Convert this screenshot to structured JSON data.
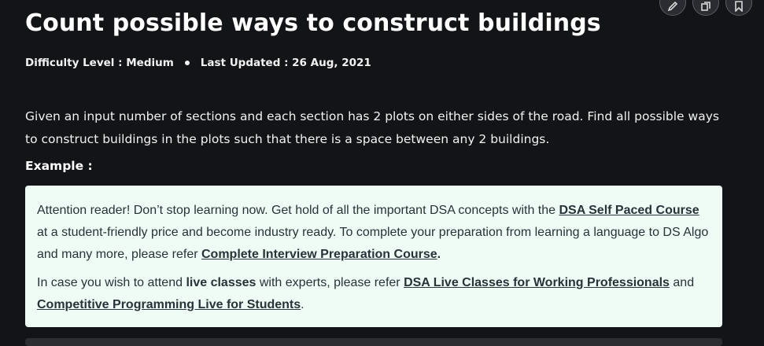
{
  "article": {
    "title": "Count possible ways to construct buildings",
    "difficulty": "Difficulty Level : Medium",
    "last_updated": "Last Updated : 26 Aug, 2021",
    "description": "Given an input number of sections and each section has 2 plots on either sides of the road. Find all possible ways to construct buildings in the plots such that there is a space between any 2 buildings.",
    "example_label": "Example :"
  },
  "toolbar": {
    "icons": [
      "pencil-icon",
      "copy-icon",
      "bookmark-icon"
    ]
  },
  "notice": {
    "p1_text_a": "Attention reader! Don’t stop learning now. Get hold of all the important DSA concepts with the ",
    "p1_link1": "DSA Self Paced Course",
    "p1_text_b": " at a student-friendly price and become industry ready.  To complete your preparation from learning a language to DS Algo and many more,  please refer ",
    "p1_link2": "Complete Interview Preparation Course",
    "p1_text_c": ".",
    "p2_text_a": "In case you wish to attend ",
    "p2_bold": "live classes",
    "p2_text_b": " with experts, please refer ",
    "p2_link1": "DSA Live Classes for Working Professionals",
    "p2_text_c": " and ",
    "p2_link2": "Competitive Programming Live for Students",
    "p2_text_d": "."
  },
  "colors": {
    "background": "#131417",
    "notice_bg": "#effcf5",
    "notice_text": "#273239"
  }
}
